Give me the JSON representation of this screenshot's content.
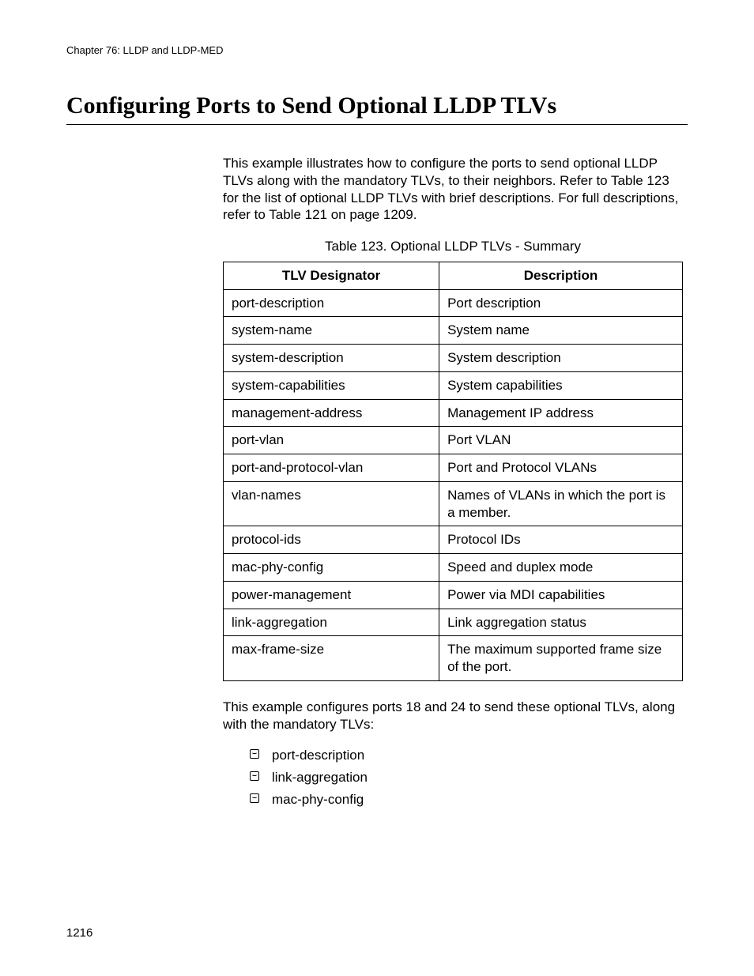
{
  "running_head": "Chapter 76: LLDP and LLDP-MED",
  "section_title": "Configuring Ports to Send Optional LLDP TLVs",
  "intro_paragraph": "This example illustrates how to configure the ports to send optional LLDP TLVs along with the mandatory TLVs, to their neighbors. Refer to Table 123 for the list of optional LLDP TLVs with brief descriptions. For full descriptions, refer to Table 121 on page 1209.",
  "table_caption": "Table 123. Optional LLDP TLVs - Summary",
  "table_headers": {
    "col1": "TLV Designator",
    "col2": "Description"
  },
  "table_rows": [
    {
      "designator": "port-description",
      "description": "Port description"
    },
    {
      "designator": "system-name",
      "description": "System name"
    },
    {
      "designator": "system-description",
      "description": "System description"
    },
    {
      "designator": "system-capabilities",
      "description": "System capabilities"
    },
    {
      "designator": "management-address",
      "description": "Management IP address"
    },
    {
      "designator": "port-vlan",
      "description": "Port VLAN"
    },
    {
      "designator": "port-and-protocol-vlan",
      "description": "Port and Protocol VLANs"
    },
    {
      "designator": "vlan-names",
      "description": "Names of VLANs in which the port is a member."
    },
    {
      "designator": "protocol-ids",
      "description": "Protocol IDs"
    },
    {
      "designator": "mac-phy-config",
      "description": "Speed and duplex mode"
    },
    {
      "designator": "power-management",
      "description": "Power via MDI capabilities"
    },
    {
      "designator": "link-aggregation",
      "description": "Link aggregation status"
    },
    {
      "designator": "max-frame-size",
      "description": "The maximum supported frame size of the port."
    }
  ],
  "example_intro": "This example configures ports 18 and 24 to send these optional TLVs, along with the mandatory TLVs:",
  "bullets": [
    "port-description",
    "link-aggregation",
    "mac-phy-config"
  ],
  "page_number": "1216"
}
